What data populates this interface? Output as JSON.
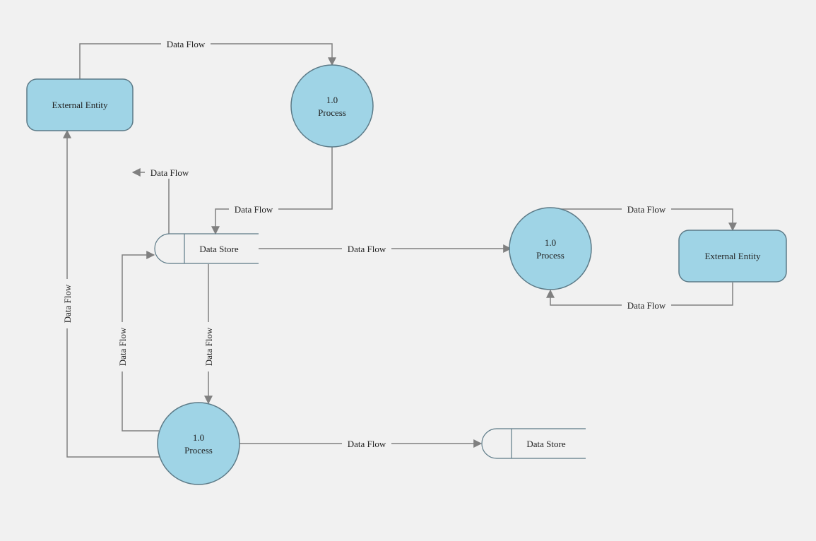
{
  "nodes": {
    "ext1": {
      "label": "External Entity"
    },
    "ext2": {
      "label": "External Entity"
    },
    "proc1": {
      "line1": "1.0",
      "line2": "Process"
    },
    "proc2": {
      "line1": "1.0",
      "line2": "Process"
    },
    "proc3": {
      "line1": "1.0",
      "line2": "Process"
    },
    "ds1": {
      "label": "Data Store"
    },
    "ds2": {
      "label": "Data Store"
    }
  },
  "edges": {
    "e1": "Data Flow",
    "e2": "Data Flow",
    "e3": "Data Flow",
    "e4": "Data Flow",
    "e5": "Data Flow",
    "e6": "Data Flow",
    "e7": "Data Flow",
    "e8": "Data Flow",
    "e9": "Data Flow",
    "e10": "Data Flow"
  }
}
